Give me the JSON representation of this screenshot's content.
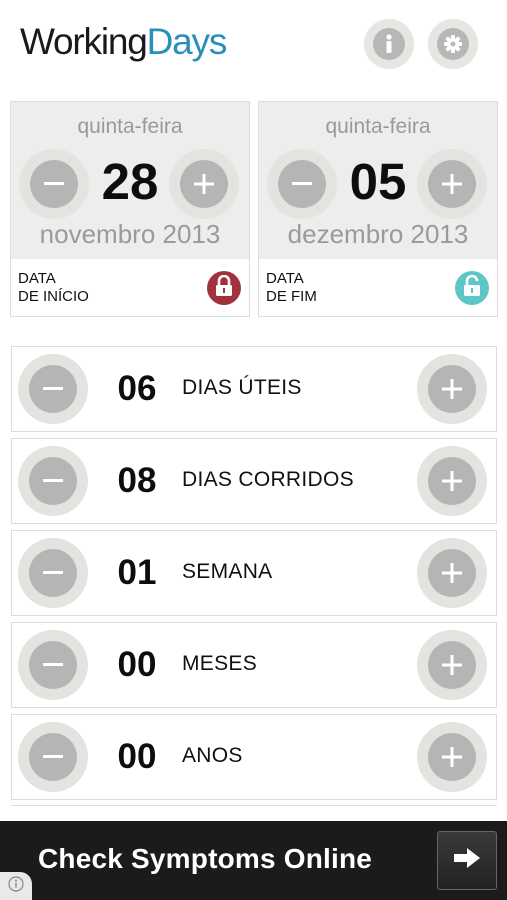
{
  "app": {
    "logo_part1": "Working",
    "logo_part2": "Days",
    "info_icon_glyph": "i",
    "accent_color": "#2a8fb8"
  },
  "start_date": {
    "weekday": "quinta-feira",
    "day": "28",
    "month_year": "novembro 2013",
    "label_line1": "DATA",
    "label_line2": "DE INÍCIO",
    "lock_state": "locked",
    "lock_color": "#a3313c"
  },
  "end_date": {
    "weekday": "quinta-feira",
    "day": "05",
    "month_year": "dezembro 2013",
    "label_line1": "DATA",
    "label_line2": "DE FIM",
    "lock_state": "unlocked",
    "lock_color": "#5cc7c9"
  },
  "counters": [
    {
      "value": "06",
      "unit": "DIAS ÚTEIS"
    },
    {
      "value": "08",
      "unit": "DIAS CORRIDOS"
    },
    {
      "value": "01",
      "unit": "SEMANA"
    },
    {
      "value": "00",
      "unit": "MESES"
    },
    {
      "value": "00",
      "unit": "ANOS"
    }
  ],
  "ad": {
    "text": "Check Symptoms Online",
    "arrow_icon": "right-arrow-icon",
    "info_icon": "info-icon"
  }
}
